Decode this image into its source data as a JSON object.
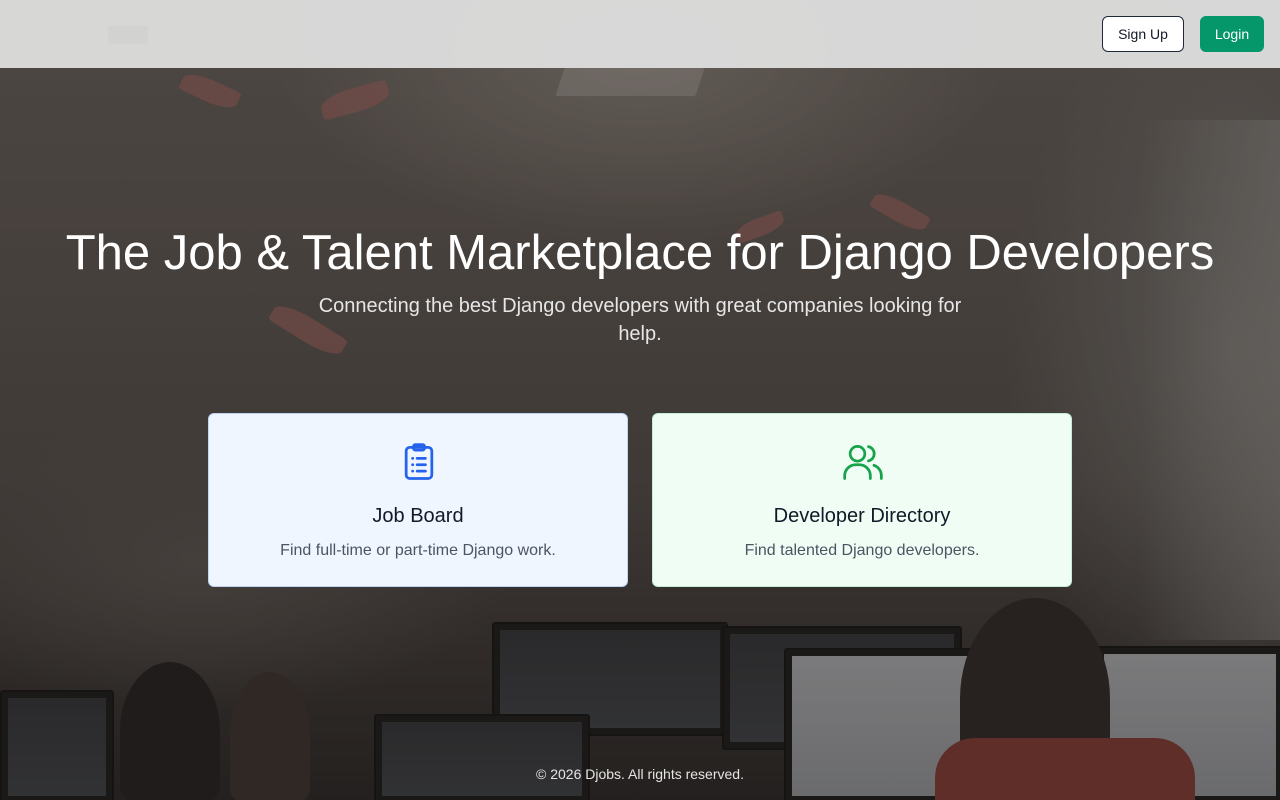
{
  "header": {
    "signup_label": "Sign Up",
    "login_label": "Login",
    "signup_color": "#ffffff",
    "login_color": "#059669"
  },
  "hero": {
    "title": "The Job & Talent Marketplace for Django Developers",
    "subtitle": "Connecting the best Django developers with great companies looking for help."
  },
  "cards": [
    {
      "title": "Job Board",
      "description": "Find full-time or part-time Django work.",
      "icon": "clipboard-list-icon",
      "icon_color": "#2563eb",
      "background": "#eff6ff"
    },
    {
      "title": "Developer Directory",
      "description": "Find talented Django developers.",
      "icon": "users-icon",
      "icon_color": "#16a34a",
      "background": "#effdf4"
    }
  ],
  "footer": {
    "copyright": "© 2026 Djobs. All rights reserved."
  }
}
